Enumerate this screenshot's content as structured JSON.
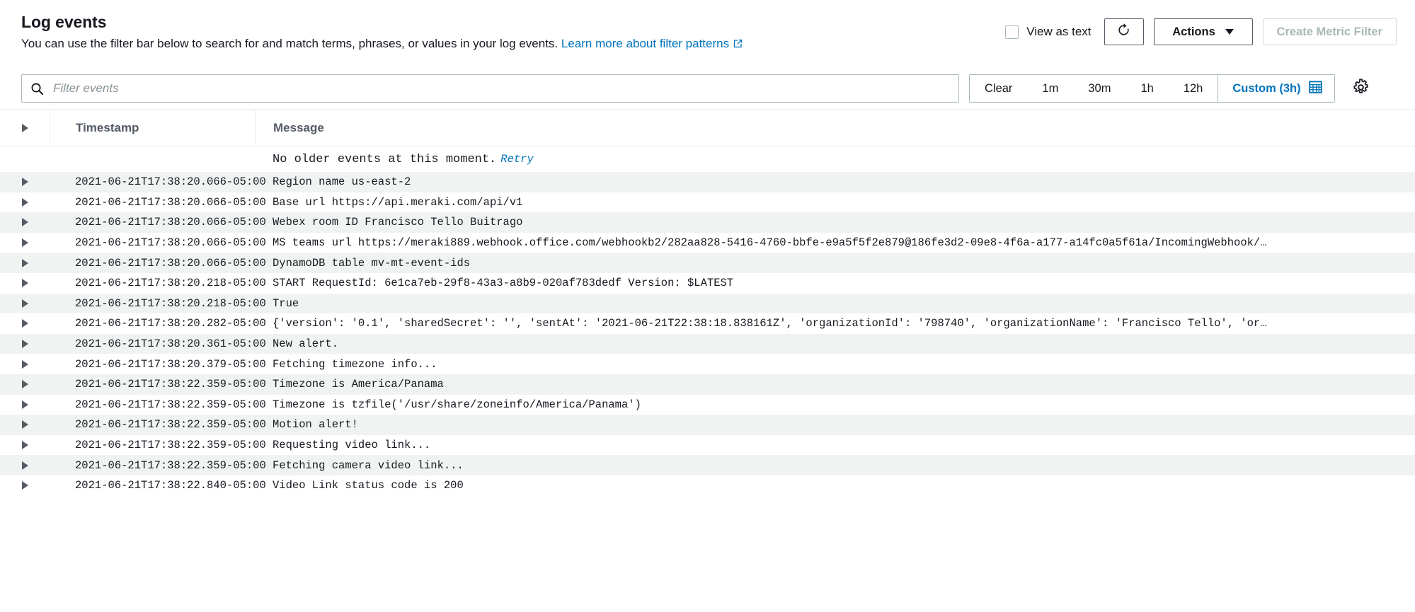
{
  "header": {
    "title": "Log events",
    "description": "You can use the filter bar below to search for and match terms, phrases, or values in your log events.",
    "learn_more_label": "Learn more about filter patterns",
    "view_as_text_label": "View as text",
    "refresh_icon": "refresh-icon",
    "actions_label": "Actions",
    "create_metric_filter_label": "Create Metric Filter",
    "link_color": "#0073bb"
  },
  "filter": {
    "placeholder": "Filter events",
    "value": "",
    "search_icon": "search-icon",
    "settings_icon": "gear-icon"
  },
  "time_range": {
    "buttons": [
      "Clear",
      "1m",
      "30m",
      "1h",
      "12h"
    ],
    "custom_label": "Custom (3h)",
    "calendar_icon": "calendar-icon",
    "active_color": "#0073bb"
  },
  "table": {
    "columns": [
      "Timestamp",
      "Message"
    ],
    "notice": "No older events at this moment.",
    "retry_label": "Retry",
    "rows": [
      {
        "timestamp": "2021-06-21T17:38:20.066-05:00",
        "message": "Region name us-east-2"
      },
      {
        "timestamp": "2021-06-21T17:38:20.066-05:00",
        "message": "Base url https://api.meraki.com/api/v1"
      },
      {
        "timestamp": "2021-06-21T17:38:20.066-05:00",
        "message": "Webex room ID Francisco Tello Buitrago"
      },
      {
        "timestamp": "2021-06-21T17:38:20.066-05:00",
        "message": "MS teams url https://meraki889.webhook.office.com/webhookb2/282aa828-5416-4760-bbfe-e9a5f5f2e879@186fe3d2-09e8-4f6a-a177-a14fc0a5f61a/IncomingWebhook/…"
      },
      {
        "timestamp": "2021-06-21T17:38:20.066-05:00",
        "message": "DynamoDB table mv-mt-event-ids"
      },
      {
        "timestamp": "2021-06-21T17:38:20.218-05:00",
        "message": "START RequestId: 6e1ca7eb-29f8-43a3-a8b9-020af783dedf Version: $LATEST"
      },
      {
        "timestamp": "2021-06-21T17:38:20.218-05:00",
        "message": "True"
      },
      {
        "timestamp": "2021-06-21T17:38:20.282-05:00",
        "message": "{'version': '0.1', 'sharedSecret': '', 'sentAt': '2021-06-21T22:38:18.838161Z', 'organizationId': '798740', 'organizationName': 'Francisco Tello', 'or…"
      },
      {
        "timestamp": "2021-06-21T17:38:20.361-05:00",
        "message": "New alert."
      },
      {
        "timestamp": "2021-06-21T17:38:20.379-05:00",
        "message": "Fetching timezone info..."
      },
      {
        "timestamp": "2021-06-21T17:38:22.359-05:00",
        "message": "Timezone is America/Panama"
      },
      {
        "timestamp": "2021-06-21T17:38:22.359-05:00",
        "message": "Timezone is tzfile('/usr/share/zoneinfo/America/Panama')"
      },
      {
        "timestamp": "2021-06-21T17:38:22.359-05:00",
        "message": "Motion alert!"
      },
      {
        "timestamp": "2021-06-21T17:38:22.359-05:00",
        "message": "Requesting video link..."
      },
      {
        "timestamp": "2021-06-21T17:38:22.359-05:00",
        "message": "Fetching camera video link..."
      },
      {
        "timestamp": "2021-06-21T17:38:22.840-05:00",
        "message": "Video Link status code is 200"
      }
    ]
  }
}
